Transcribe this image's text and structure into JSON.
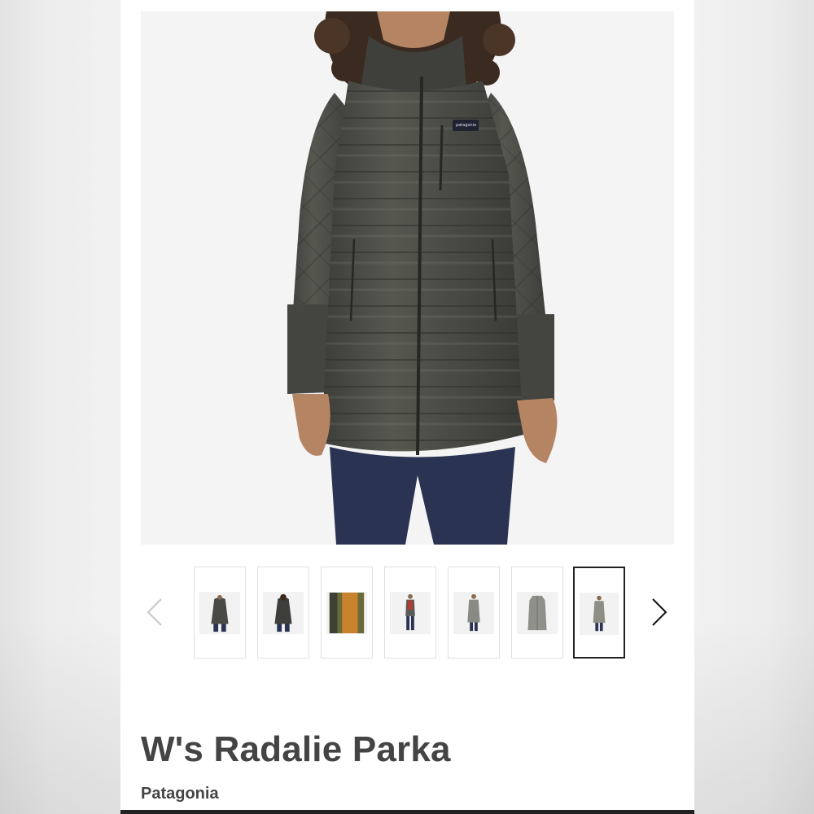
{
  "product": {
    "title": "W's Radalie Parka",
    "brand": "Patagonia",
    "chest_logo": "patagonia"
  },
  "gallery": {
    "selected_index": 6,
    "prev_icon": "chevron-left-icon",
    "next_icon": "chevron-right-icon",
    "thumbnails": [
      {
        "name": "front-view",
        "color": "#4a4a45"
      },
      {
        "name": "back-view",
        "color": "#3e3e3a"
      },
      {
        "name": "open-jacket-detail",
        "color": "#6a6a3a"
      },
      {
        "name": "full-length-red",
        "color": "#5a5a58"
      },
      {
        "name": "full-length-gray",
        "color": "#8a8a85"
      },
      {
        "name": "flat-lay-gray",
        "color": "#8f9089"
      },
      {
        "name": "full-length-sage",
        "color": "#8d8e86"
      }
    ]
  },
  "colors": {
    "jacket": "#4b4c46",
    "jacket_light": "#5c5d57",
    "jeans": "#2a3352",
    "title_text": "#444444"
  }
}
